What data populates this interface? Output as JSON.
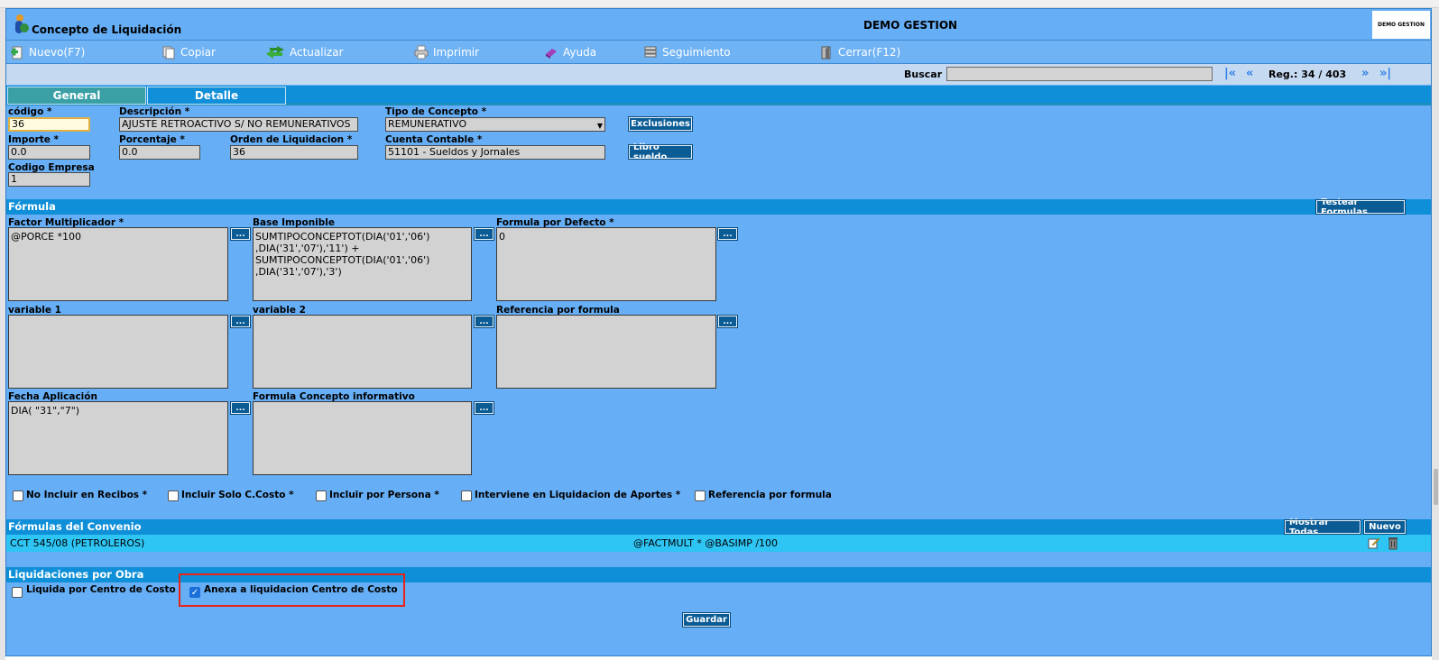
{
  "window": {
    "title": "Concepto de Liquidación",
    "company": "DEMO GESTION",
    "company_logo": "DEMO GESTION"
  },
  "toolbar": {
    "items": [
      {
        "label": "Nuevo(F7)",
        "icon": "new-document-icon"
      },
      {
        "label": "Copiar",
        "icon": "copy-icon"
      },
      {
        "label": "Actualizar",
        "icon": "refresh-icon"
      },
      {
        "label": "Imprimir",
        "icon": "printer-icon"
      },
      {
        "label": "Ayuda",
        "icon": "help-book-icon"
      },
      {
        "label": "Seguimiento",
        "icon": "tracking-stack-icon"
      },
      {
        "label": "Cerrar(F12)",
        "icon": "close-door-icon"
      }
    ]
  },
  "search": {
    "label": "Buscar",
    "value": "",
    "nav_first": "|«",
    "nav_prev": "«",
    "record_info": "Reg.: 34 / 403",
    "nav_next": "»",
    "nav_last": "»|"
  },
  "tabs": [
    {
      "label": "General",
      "active": true
    },
    {
      "label": "Detalle",
      "active": false
    }
  ],
  "form": {
    "codigo_label": "código *",
    "codigo_value": "36",
    "descripcion_label": "Descripción *",
    "descripcion_value": "AJUSTE RETROACTIVO  S/ NO REMUNERATIVOS",
    "tipo_label": "Tipo de Concepto *",
    "tipo_value": "REMUNERATIVO",
    "exclusiones_button": "Exclusiones",
    "importe_label": "Importe *",
    "importe_value": "0.0",
    "porcentaje_label": "Porcentaje *",
    "porcentaje_value": "0.0",
    "orden_label": "Orden de Liquidacion *",
    "orden_value": "36",
    "cuenta_label": "Cuenta Contable *",
    "cuenta_value": "51101 - Sueldos y Jornales",
    "libro_button": "Libro sueldo",
    "empresa_label": "Codigo Empresa",
    "empresa_value": "1"
  },
  "formula": {
    "section_title": "Fórmula",
    "test_button": "Testear Formulas",
    "factor_label": "Factor Multiplicador *",
    "factor_value": "@PORCE *100",
    "base_label": "Base Imponible",
    "base_value": "SUMTIPOCONCEPTOT(DIA('01','06')\n,DIA('31','07'),'11') +\nSUMTIPOCONCEPTOT(DIA('01','06')\n,DIA('31','07'),'3')",
    "defecto_label": "Formula por Defecto *",
    "defecto_value": "0",
    "var1_label": "variable 1",
    "var1_value": "",
    "var2_label": "variable 2",
    "var2_value": "",
    "referencia_label": "Referencia por formula",
    "referencia_value": "",
    "fecha_label": "Fecha Aplicación",
    "fecha_value": "DIA( \"31\",\"7\")",
    "informativo_label": "Formula Concepto informativo",
    "informativo_value": "",
    "dots_label": "..."
  },
  "checkboxes": [
    {
      "label": "No Incluir en Recibos *",
      "checked": false
    },
    {
      "label": "Incluir Solo C.Costo *",
      "checked": false
    },
    {
      "label": "Incluir por Persona *",
      "checked": false
    },
    {
      "label": "Interviene en Liquidacion de Aportes *",
      "checked": false
    },
    {
      "label": "Referencia por formula",
      "checked": false
    }
  ],
  "convenio": {
    "section_title": "Fórmulas del Convenio",
    "show_all_button": "Mostrar Todas",
    "new_button": "Nuevo",
    "rows": [
      {
        "name": "CCT 545/08 (PETROLEROS)",
        "formula": "@FACTMULT * @BASIMP /100"
      }
    ]
  },
  "obra": {
    "section_title": "Liquidaciones por Obra",
    "centro_label": "Liquida por Centro de Costo",
    "centro_checked": false,
    "anexa_label": "Anexa a liquidacion Centro de Costo",
    "anexa_checked": true
  },
  "save_button": "Guardar",
  "colors": {
    "background": "#66aef5",
    "section_bar": "#0f8fd8",
    "button": "#0b5c95",
    "highlight": "#e8231a"
  }
}
